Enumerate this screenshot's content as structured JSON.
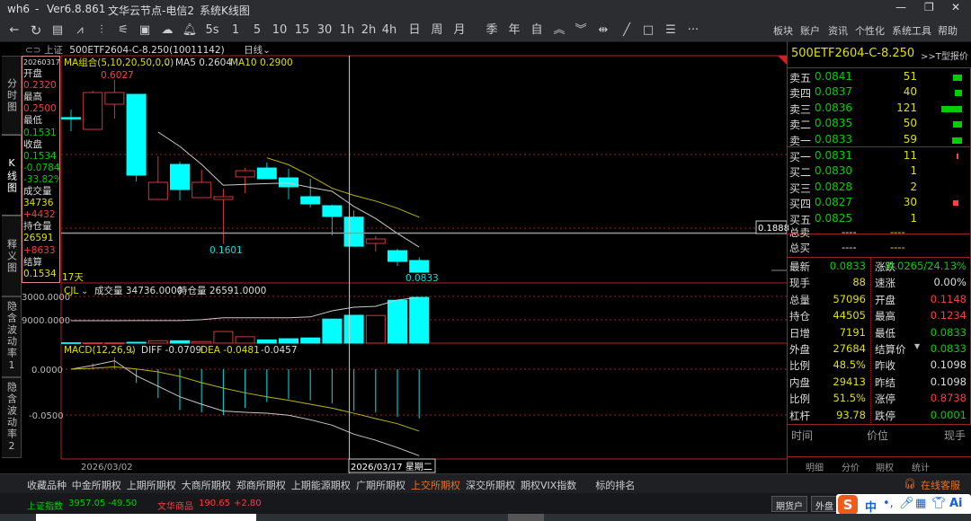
{
  "titlebar": {
    "app": "wh6",
    "sep": "-",
    "version": "Ver6.8.861",
    "server": "文华云节点-电信2",
    "view": "系统K线图",
    "buttons": [
      "minimize",
      "maximize",
      "close"
    ]
  },
  "toolbar": {
    "icons": [
      "back-arrow-icon",
      "refresh-icon",
      "table-icon",
      "line-chart-icon",
      "candlestick-icon",
      "split-chart-icon",
      "frame-chart-icon",
      "cloud-lightning-icon",
      "bell-icon"
    ],
    "periods": [
      "5s",
      "1",
      "5",
      "10",
      "15",
      "30",
      "1h",
      "2h",
      "4h",
      "日",
      "周",
      "月",
      "季",
      "年",
      "自"
    ],
    "tools": [
      "double-up-icon",
      "double-down-icon",
      "insert-column-icon",
      "draw-line-icon",
      "rectangle-icon",
      "list-icon",
      "more-icon"
    ],
    "menu": [
      "板块",
      "账户",
      "资讯",
      "个性化",
      "系统工具",
      "帮助"
    ]
  },
  "left_tabs": [
    "分时图",
    "K线图",
    "释义图",
    "隐含波动率1",
    "隐含波动率2"
  ],
  "chart_header": {
    "exchange": "上证",
    "contract": "500ETF2604-C-8.250(10011142)",
    "period": "日线"
  },
  "info": {
    "date": "20260317",
    "open_label": "开盘",
    "open": "0.2320",
    "high_label": "最高",
    "high": "0.2500",
    "low_label": "最低",
    "low": "0.1531",
    "close_label": "收盘",
    "close": "0.1534",
    "change": "-0.0784",
    "change_pct": "-33.82%",
    "volume_label": "成交量",
    "volume": "34736",
    "volume_change": "+4432",
    "oi_label": "持仓量",
    "oi": "26591",
    "oi_change": "+8633",
    "settle_label": "结算",
    "settle": "0.1534"
  },
  "main_chart": {
    "indicator": "MA组合(5,10,20,50,0,0)",
    "ma5": "MA5 0.2604",
    "ma10": "MA10 0.2900",
    "high_label": "0.6027",
    "low_label": "0.1601",
    "last_label": "0.0833",
    "days": "17天",
    "cursor_price": "0.1888"
  },
  "volume_chart": {
    "indicator": "CJL",
    "volume": "成交量 34736.0000",
    "oi": "持仓量 26591.0000",
    "ticks": [
      "3000.0000",
      "9000.0000"
    ]
  },
  "macd_chart": {
    "indicator": "MACD(12,26,9)",
    "diff": "DIFF -0.0709",
    "dea": "DEA -0.0481",
    "macd": "-0.0457",
    "ticks": [
      "0.0000",
      "-0.0500"
    ]
  },
  "x_axis": {
    "start": "2026/03/02",
    "cursor": "2026/03/17 星期二"
  },
  "chart_data": {
    "type": "candlestick",
    "dates_shown": [
      "2026/03/02",
      "2026/03/17"
    ],
    "candles": [
      {
        "o": 0.501,
        "h": 0.5226,
        "l": 0.4643,
        "c": 0.5007
      },
      {
        "o": 0.4692,
        "h": 0.5736,
        "l": 0.4692,
        "c": 0.5687
      },
      {
        "o": 0.5371,
        "h": 0.6027,
        "l": 0.4983,
        "c": 0.5687
      },
      {
        "o": 0.5638,
        "h": 0.5638,
        "l": 0.3284,
        "c": 0.3454
      },
      {
        "o": 0.2799,
        "h": 0.3964,
        "l": 0.2799,
        "c": 0.326
      },
      {
        "o": 0.3745,
        "h": 0.3818,
        "l": 0.2775,
        "c": 0.3066
      },
      {
        "o": 0.2847,
        "h": 0.36,
        "l": 0.2847,
        "c": 0.326
      },
      {
        "o": 0.2799,
        "h": 0.309,
        "l": 0.1601,
        "c": 0.2872
      },
      {
        "o": 0.3406,
        "h": 0.3648,
        "l": 0.2969,
        "c": 0.3575
      },
      {
        "o": 0.3648,
        "h": 0.3794,
        "l": 0.3357,
        "c": 0.3357
      },
      {
        "o": 0.3381,
        "h": 0.3624,
        "l": 0.2799,
        "c": 0.3139
      },
      {
        "o": 0.2872,
        "h": 0.3357,
        "l": 0.258,
        "c": 0.2678
      },
      {
        "o": 0.2629,
        "h": 0.2653,
        "l": 0.1828,
        "c": 0.2338
      },
      {
        "o": 0.232,
        "h": 0.25,
        "l": 0.1531,
        "c": 0.1534
      },
      {
        "o": 0.161,
        "h": 0.1804,
        "l": 0.1391,
        "c": 0.1731
      },
      {
        "o": 0.1415,
        "h": 0.1464,
        "l": 0.1003,
        "c": 0.1124
      },
      {
        "o": 0.1148,
        "h": 0.1234,
        "l": 0.0833,
        "c": 0.0833
      }
    ],
    "volume": [
      500,
      300,
      300,
      1100,
      3000,
      3000,
      2000,
      14500,
      8000,
      4000,
      5500,
      6500,
      30000,
      34736,
      34500,
      53500,
      57096
    ],
    "open_interest": [
      2200,
      2200,
      2200,
      2400,
      2400,
      2400,
      4000,
      7400,
      7400,
      7400,
      7400,
      9000,
      20000,
      26591,
      28200,
      39600,
      44505
    ],
    "diff": [
      0,
      0.0042,
      0.0092,
      -0.0072,
      -0.0186,
      -0.0301,
      -0.0382,
      -0.0457,
      -0.047,
      -0.048,
      -0.0503,
      -0.0552,
      -0.0611,
      -0.0709,
      -0.0775,
      -0.0856,
      -0.0944
    ],
    "dea": [
      0,
      0.001,
      0.0026,
      0.0003,
      -0.0029,
      -0.0078,
      -0.0147,
      -0.0206,
      -0.0258,
      -0.0301,
      -0.034,
      -0.0382,
      -0.0425,
      -0.0481,
      -0.0539,
      -0.0595,
      -0.0676
    ],
    "cursor_index": 13,
    "cursor_price": 0.1888,
    "colors": {
      "up": "#d03838",
      "down": "#00ffff",
      "ma5": "#c8c8c8",
      "ma10": "#b8b800",
      "oi": "#c8c8c8",
      "dea": "#b8b800"
    }
  },
  "right_panel": {
    "title": "500ETF2604-C-8.250",
    "tquote": ">>T型报价",
    "asks": [
      {
        "label": "卖五",
        "price": "0.0841",
        "qty": "51",
        "bar": 51
      },
      {
        "label": "卖四",
        "price": "0.0837",
        "qty": "40",
        "bar": 40
      },
      {
        "label": "卖三",
        "price": "0.0836",
        "qty": "121",
        "bar": 121
      },
      {
        "label": "卖二",
        "price": "0.0835",
        "qty": "50",
        "bar": 50
      },
      {
        "label": "卖一",
        "price": "0.0833",
        "qty": "59",
        "bar": 59
      }
    ],
    "bids": [
      {
        "label": "买一",
        "price": "0.0831",
        "qty": "11",
        "bar": 11
      },
      {
        "label": "买二",
        "price": "0.0830",
        "qty": "1",
        "bar": 1
      },
      {
        "label": "买三",
        "price": "0.0828",
        "qty": "2",
        "bar": 2
      },
      {
        "label": "买四",
        "price": "0.0827",
        "qty": "30",
        "bar": 30
      },
      {
        "label": "买五",
        "price": "0.0825",
        "qty": "1",
        "bar": 1
      }
    ],
    "total_sell": {
      "label": "总卖",
      "a": "----",
      "b": "----"
    },
    "total_buy": {
      "label": "总买",
      "a": "----",
      "b": "----"
    },
    "stats_left": [
      {
        "k": "最新",
        "v": "0.0833",
        "c": "g"
      },
      {
        "k": "现手",
        "v": "88",
        "c": "y"
      },
      {
        "k": "总量",
        "v": "57096",
        "c": "y"
      },
      {
        "k": "持仓",
        "v": "44505",
        "c": "y"
      },
      {
        "k": "日增",
        "v": "7191",
        "c": "y"
      },
      {
        "k": "外盘",
        "v": "27684",
        "c": "y"
      },
      {
        "k": "比例",
        "v": "48.5%",
        "c": "y"
      },
      {
        "k": "内盘",
        "v": "29413",
        "c": "y"
      },
      {
        "k": "比例",
        "v": "51.5%",
        "c": "y"
      },
      {
        "k": "杠杆",
        "v": "93.78",
        "c": "y"
      }
    ],
    "stats_right": [
      {
        "k": "涨跌",
        "v": "-0.0265/24.13%",
        "c": "g"
      },
      {
        "k": "速涨",
        "v": "0.00%",
        "c": "w"
      },
      {
        "k": "开盘",
        "v": "0.1148",
        "c": "r"
      },
      {
        "k": "最高",
        "v": "0.1234",
        "c": "r"
      },
      {
        "k": "最低",
        "v": "0.0833",
        "c": "g"
      },
      {
        "k": "结算价",
        "v": "0.0833",
        "c": "g"
      },
      {
        "k": "昨收",
        "v": "0.1098",
        "c": "w"
      },
      {
        "k": "昨结",
        "v": "0.1098",
        "c": "w"
      },
      {
        "k": "涨停",
        "v": "0.8738",
        "c": "r"
      },
      {
        "k": "跌停",
        "v": "0.0001",
        "c": "g"
      }
    ],
    "ticks_header": [
      "时间",
      "价位",
      "现手"
    ],
    "tabs": [
      "明细",
      "分价",
      "期权",
      "统计"
    ]
  },
  "bottom_tabs": {
    "items": [
      "收藏品种",
      "中金所期权",
      "上期所期权",
      "大商所期权",
      "郑商所期权",
      "上期能源期权",
      "广期所期权",
      "上交所期权",
      "深交所期权",
      "期权VIX指数",
      "标的排名"
    ],
    "active": 7,
    "service": "在线客服"
  },
  "status": {
    "idx1_name": "上证指数",
    "idx1_val": "3957.05",
    "idx1_chg": "-49.50",
    "idx2_name": "文华商品",
    "idx2_val": "190.65",
    "idx2_chg": "+2.80",
    "btn1": "期货户",
    "btn2": "外盘",
    "ime": "中"
  }
}
